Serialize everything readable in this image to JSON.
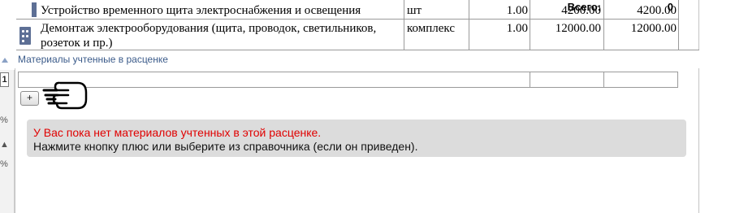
{
  "work_rows": [
    {
      "name": "Устройство временного щита электроснабжения и освещения",
      "unit": "шт",
      "quantity": "1.00",
      "price": "4200.00",
      "total": "4200.00"
    },
    {
      "name_line1": "Демонтаж электрооборудования (щита, проводок, светильников,",
      "name_line2": "розеток и пр.)",
      "unit": "комплекс",
      "quantity": "1.00",
      "price": "12000.00",
      "total": "12000.00"
    }
  ],
  "materials_section": {
    "title": "Материалы учтенные в расценке",
    "total_label": "Всего:",
    "total_value": "0",
    "add_button_label": "+",
    "empty_message": {
      "line1": "У Вас пока нет материалов учтенных в этой расценке.",
      "line2": "Нажмите кнопку плюс или выберите из справочника (если он приведен)."
    }
  },
  "gutter": {
    "box_label": "1",
    "icons": [
      "%",
      "▲",
      "%"
    ]
  },
  "colors": {
    "link": "#3b5b8a",
    "error_text": "#e00000",
    "message_bg": "#dcdcdc",
    "drag_handle": "#5d6f95"
  }
}
